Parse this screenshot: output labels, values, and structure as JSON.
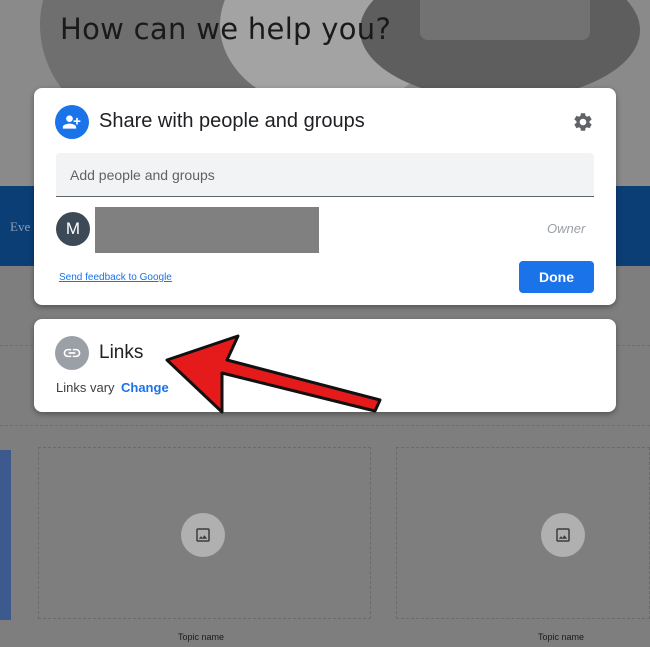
{
  "background": {
    "hero_title": "How can we help you?",
    "band_text": "Eve",
    "tiles": [
      {
        "icon": "image-icon",
        "label": "Topic name"
      },
      {
        "icon": "image-icon",
        "label": "Topic name"
      }
    ]
  },
  "share_dialog": {
    "title": "Share with people and groups",
    "title_icon": "person-add-icon",
    "settings_icon": "gear-icon",
    "add_field_placeholder": "Add people and groups",
    "owner_row": {
      "avatar_letter": "M",
      "role": "Owner"
    },
    "feedback_link": "Send feedback to Google",
    "done_label": "Done"
  },
  "links_card": {
    "title": "Links",
    "title_icon": "link-icon",
    "status": "Links vary",
    "change_label": "Change"
  },
  "annotation": {
    "arrow_color": "#e51b1b",
    "points_to": "links-title"
  },
  "colors": {
    "accent": "#1a73e8",
    "owner_avatar": "#3c4a57"
  }
}
